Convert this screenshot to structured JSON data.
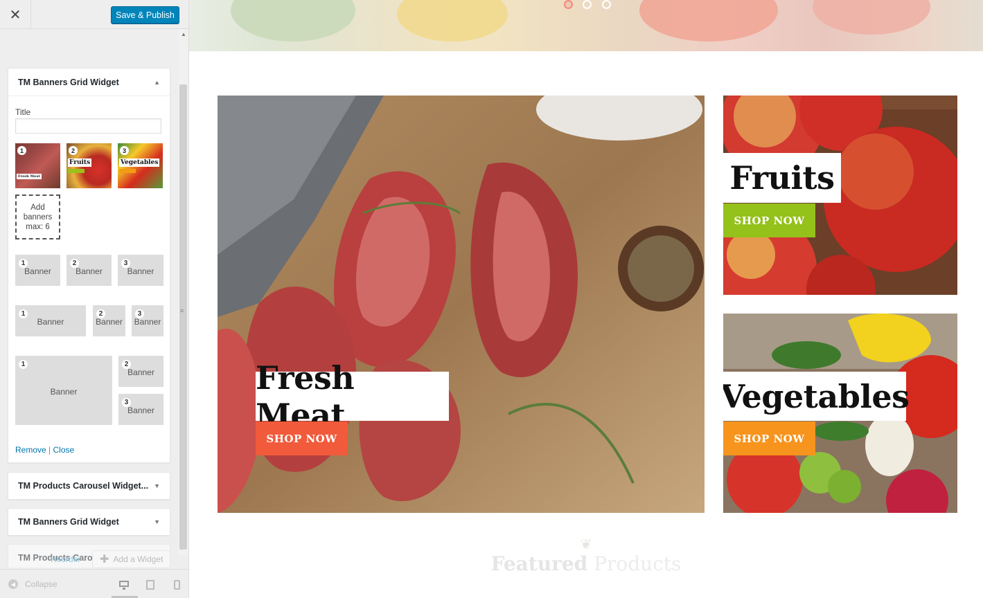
{
  "header": {
    "close_icon": "close-icon",
    "save_label": "Save & Publish"
  },
  "widgets": [
    {
      "title": "TM Banners Grid Widget",
      "expanded": true
    },
    {
      "title": "TM Products Carousel Widget...",
      "expanded": false
    },
    {
      "title": "TM Banners Grid Widget",
      "expanded": false
    },
    {
      "title": "TM Products Carousel Widget...",
      "expanded": false
    }
  ],
  "form": {
    "title_label": "Title",
    "title_value": "",
    "thumbs": [
      {
        "num": "1",
        "label": "Fresh Meat"
      },
      {
        "num": "2",
        "label": "Fruits"
      },
      {
        "num": "3",
        "label": "Vegetables"
      }
    ],
    "add_banners": {
      "line1": "Add",
      "line2": "banners",
      "line3": "max: 6"
    },
    "layouts": {
      "row1": [
        {
          "num": "1",
          "label": "Banner"
        },
        {
          "num": "2",
          "label": "Banner"
        },
        {
          "num": "3",
          "label": "Banner"
        }
      ],
      "row2": [
        {
          "num": "1",
          "label": "Banner"
        },
        {
          "num": "2",
          "label": "Banner"
        },
        {
          "num": "3",
          "label": "Banner"
        }
      ],
      "row3": [
        {
          "num": "1",
          "label": "Banner"
        },
        {
          "num": "2",
          "label": "Banner"
        },
        {
          "num": "3",
          "label": "Banner"
        }
      ]
    },
    "remove_label": "Remove",
    "separator": "|",
    "close_label": "Close"
  },
  "sidebar_actions": {
    "reorder_label": "Reorder",
    "add_widget_label": "Add a Widget"
  },
  "footer": {
    "collapse_label": "Collapse"
  },
  "preview": {
    "banners": [
      {
        "title": "Fresh Meat",
        "button": "SHOP NOW",
        "button_color": "#f15a3b"
      },
      {
        "title": "Fruits",
        "button": "SHOP NOW",
        "button_color": "#94c11a"
      },
      {
        "title": "Vegetables",
        "button": "SHOP NOW",
        "button_color": "#f7941d"
      }
    ],
    "featured": {
      "bold": "Featured",
      "rest": "Products"
    }
  },
  "colors": {
    "primary_button": "#0085ba",
    "link": "#0073aa"
  }
}
